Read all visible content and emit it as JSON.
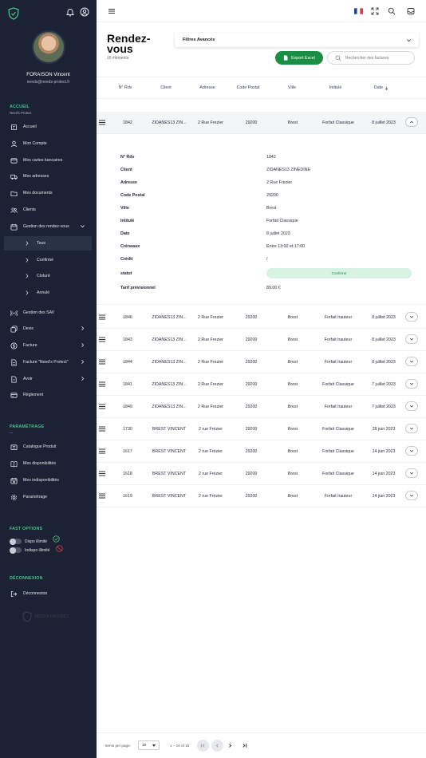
{
  "user": {
    "name": "FORAISON Vincent",
    "email": "needs@needs-protect.fr"
  },
  "sidebar": {
    "accueil_title": "ACCUEIL",
    "accueil_sub": "Need's Protect",
    "items": [
      {
        "label": "Accueil",
        "icon": "dashboard-icon"
      },
      {
        "label": "Mon Compte",
        "icon": "user-icon"
      },
      {
        "label": "Mes cartes bancaires",
        "icon": "credit-card-icon"
      },
      {
        "label": "Mes adresses",
        "icon": "truck-icon"
      },
      {
        "label": "Mes documents",
        "icon": "folder-icon"
      },
      {
        "label": "Clients",
        "icon": "users-icon"
      },
      {
        "label": "Gestion des rendez-vous",
        "icon": "calendar-icon"
      },
      {
        "label": "Tous",
        "icon": "chevron-right-icon"
      },
      {
        "label": "Confirmé",
        "icon": "chevron-right-icon"
      },
      {
        "label": "Cloturé",
        "icon": "chevron-right-icon"
      },
      {
        "label": "Annulé",
        "icon": "chevron-right-icon"
      },
      {
        "label": "Gestion des SAV",
        "icon": "broadcast-icon"
      },
      {
        "label": "Devis",
        "icon": "copy-icon"
      },
      {
        "label": "Facture",
        "icon": "currency-icon"
      },
      {
        "label": "Facture \"Need's Protect\"",
        "icon": "file-invoice-icon"
      },
      {
        "label": "Avoir",
        "icon": "file-icon"
      },
      {
        "label": "Règlement",
        "icon": "payment-icon"
      }
    ],
    "param_title": "PARAMÉTRAGE",
    "param_sub": "---",
    "param_items": [
      {
        "label": "Catalogue Produit",
        "icon": "catalog-icon"
      },
      {
        "label": "Mes disponibilités",
        "icon": "book-icon"
      },
      {
        "label": "Mes indisponibilités",
        "icon": "calendar-off-icon"
      },
      {
        "label": "Paramétrage",
        "icon": "gear-icon"
      }
    ],
    "fast_title": "FAST OPTIONS",
    "fast_items": [
      {
        "label": "Dispo illimité",
        "status_icon": "check-circle-icon"
      },
      {
        "label": "Indispo illimité",
        "status_icon": "ban-icon"
      }
    ],
    "logout_title": "DÉCONNEXION",
    "logout_label": "Déconnexion",
    "watermark": "NEED'S PROTECT"
  },
  "header": {
    "title": "Rendez-vous",
    "count": "16 éléments",
    "filters_label": "Filtres Avancés",
    "export_label": "Export Excel",
    "search_placeholder": "Rechercher des factures"
  },
  "table": {
    "columns": [
      "N° Rdv",
      "Client",
      "Adresse",
      "Code Postal",
      "Ville",
      "Intitulé",
      "Date"
    ],
    "expanded_row": {
      "rdv": "1842",
      "client": "ZIDANES13 ZIN...",
      "adresse": "2 Rue Frezier",
      "cp": "29200",
      "ville": "Brest",
      "intitule": "Forfait Classique",
      "date": "8 juillet 2023"
    },
    "detail": {
      "labels": [
        "N° Rdv",
        "Client",
        "Adresse",
        "Code Postal",
        "Ville",
        "Intitulé",
        "Date",
        "Créneaux",
        "Crédit",
        "statut",
        "Tarif prévisionnel"
      ],
      "values": [
        "1842",
        "ZIDANES13 ZINEDINE",
        "2 Rue Frezier",
        "29200",
        "Brest",
        "Forfait Classique",
        "8 juillet 2023",
        "Entre 13:00 et 17:00",
        "/",
        "Confirmé",
        "89.00 €"
      ]
    },
    "rows": [
      {
        "rdv": "1846",
        "client": "ZIDANES13 ZIN...",
        "adresse": "2 Rue Frezier",
        "cp": "29200",
        "ville": "Brest",
        "intitule": "Forfait hauteur",
        "date": "8 juillet 2023"
      },
      {
        "rdv": "1843",
        "client": "ZIDANES13 ZIN...",
        "adresse": "2 Rue Frezier",
        "cp": "29200",
        "ville": "Brest",
        "intitule": "Forfait hauteur",
        "date": "8 juillet 2023"
      },
      {
        "rdv": "1844",
        "client": "ZIDANES13 ZIN...",
        "adresse": "2 Rue Frezier",
        "cp": "29200",
        "ville": "Brest",
        "intitule": "Forfait hauteur",
        "date": "8 juillet 2023"
      },
      {
        "rdv": "1841",
        "client": "ZIDANES13 ZIN...",
        "adresse": "2 Rue Frezier",
        "cp": "29200",
        "ville": "Brest",
        "intitule": "Forfait Classique",
        "date": "7 juillet 2023"
      },
      {
        "rdv": "1849",
        "client": "ZIDANES13 ZIN...",
        "adresse": "2 Rue Frezier",
        "cp": "29200",
        "ville": "Brest",
        "intitule": "Forfait hauteur",
        "date": "7 juillet 2023"
      },
      {
        "rdv": "1730",
        "client": "BREST VINCENT",
        "adresse": "2 rue Frézier",
        "cp": "29200",
        "ville": "Brest",
        "intitule": "Forfait Classique",
        "date": "28 juin 2023"
      },
      {
        "rdv": "1617",
        "client": "BREST VINCENT",
        "adresse": "2 rue Frézier",
        "cp": "29200",
        "ville": "Brest",
        "intitule": "Forfait Classique",
        "date": "14 juin 2023"
      },
      {
        "rdv": "1618",
        "client": "BREST VINCENT",
        "adresse": "2 rue Frézier",
        "cp": "29200",
        "ville": "Brest",
        "intitule": "Forfait Classique",
        "date": "14 juin 2023"
      },
      {
        "rdv": "1619",
        "client": "BREST VINCENT",
        "adresse": "2 rue Frézier",
        "cp": "29200",
        "ville": "Brest",
        "intitule": "Forfait hauteur",
        "date": "14 juin 2023"
      }
    ]
  },
  "pagination": {
    "items_label": "Items per page:",
    "page_size": "10",
    "range": "1 – 10 of 16"
  },
  "colors": {
    "sidebar_bg": "#1a2233",
    "accent_green": "#1a8f44",
    "section_green": "#46c28a",
    "status_bg": "#d6f3e4"
  }
}
